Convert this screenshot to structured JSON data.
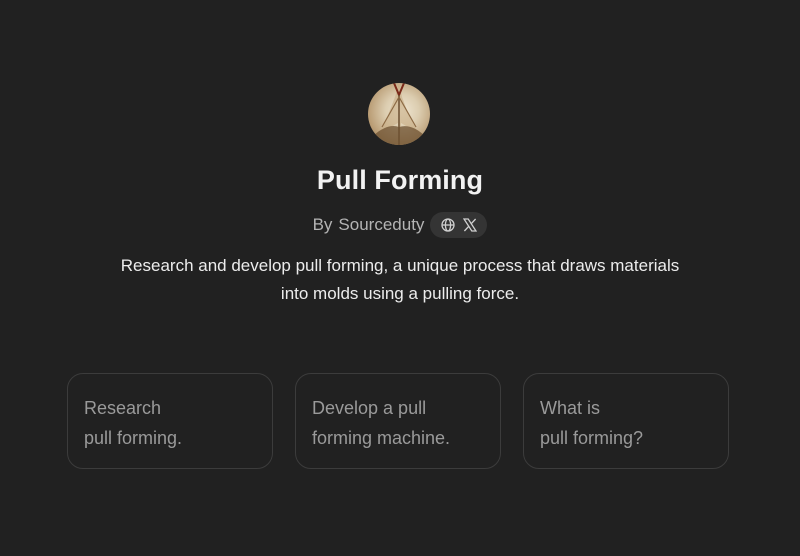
{
  "gpt": {
    "title": "Pull Forming",
    "author_prefix": "By",
    "author": "Sourceduty",
    "description": "Research and develop pull forming, a unique process that draws materials into molds using a pulling force.",
    "social_icons": [
      "globe-icon",
      "x-logo-icon"
    ]
  },
  "prompts": [
    {
      "line1": "Research",
      "line2": "pull forming."
    },
    {
      "line1": "Develop a pull",
      "line2": "forming machine."
    },
    {
      "line1": "What is",
      "line2": "pull forming?"
    }
  ],
  "colors": {
    "background": "#212121",
    "title": "#f2f2f2",
    "muted": "#b4b4b4",
    "card_border": "#3c3c3c",
    "card_text": "#9a9a9a",
    "pill": "#343434"
  }
}
